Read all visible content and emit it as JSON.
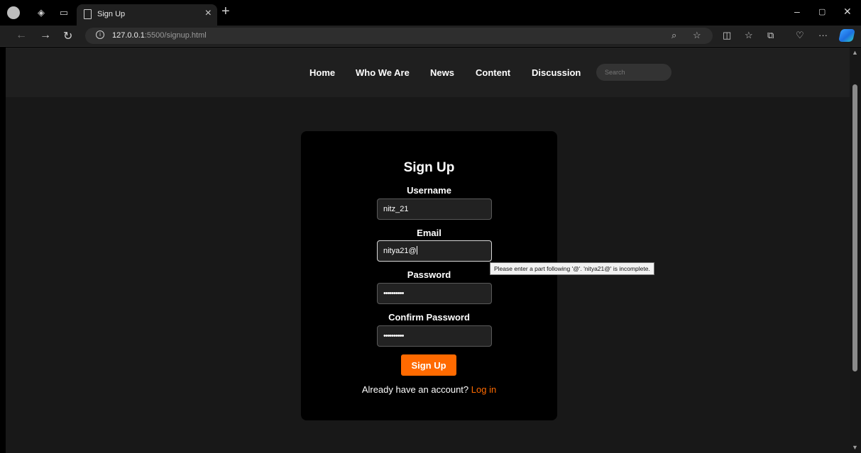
{
  "browser": {
    "tab_title": "Sign Up",
    "tab_close": "×",
    "new_tab": "+",
    "window_controls": [
      "–",
      "▢",
      "✕"
    ],
    "url_host": "127.0.0.1",
    "url_rest": ":5500/signup.html",
    "icons": [
      "profile-icon",
      "workspaces-icon",
      "tab-actions-icon",
      "back-icon",
      "forward-icon",
      "refresh-icon",
      "info-icon",
      "read-aloud-icon",
      "favorite-icon",
      "split-screen-icon",
      "favorites-icon",
      "collections-icon",
      "browser-essentials-icon",
      "more-icon",
      "copilot-icon"
    ]
  },
  "nav": {
    "links": [
      "Home",
      "Who We Are",
      "News",
      "Content",
      "Discussion"
    ],
    "search_placeholder": "Search"
  },
  "form": {
    "title": "Sign Up",
    "username_label": "Username",
    "username_value": "nitz_21",
    "email_label": "Email",
    "email_value": "nitya21@",
    "password_label": "Password",
    "password_value": "••••••••••",
    "confirm_label": "Confirm Password",
    "confirm_value": "••••••••••",
    "submit_label": "Sign Up",
    "footer_text": "Already have an account?",
    "login_link": "Log in"
  },
  "tooltip": {
    "text": "Please enter a part following '@'. 'nitya21@' is incomplete."
  },
  "colors": {
    "accent": "#ff6a00",
    "page_bg": "#181818",
    "card_bg": "#000000",
    "nav_bg": "#1f1f1f"
  }
}
